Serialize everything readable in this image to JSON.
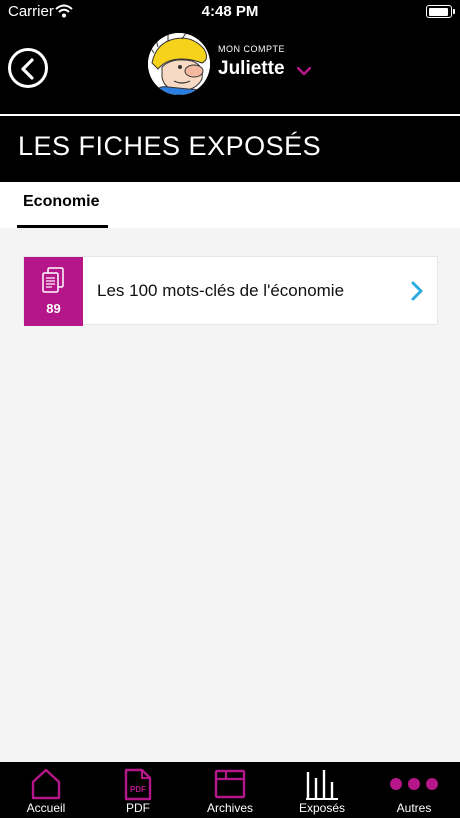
{
  "status_bar": {
    "carrier": "Carrier",
    "time": "4:48 PM"
  },
  "header": {
    "account_label": "MON COMPTE",
    "account_name": "Juliette"
  },
  "page": {
    "title": "LES FICHES EXPOSÉS"
  },
  "tabs": [
    {
      "label": "Economie",
      "active": true
    }
  ],
  "cards": [
    {
      "count": "89",
      "title": "Les 100 mots-clés de l'économie"
    }
  ],
  "colors": {
    "accent": "#b5178a",
    "chevron": "#29abe2",
    "background": "#f4f4f4"
  },
  "tab_nav": {
    "items": [
      {
        "label": "Accueil",
        "icon": "home-icon"
      },
      {
        "label": "PDF",
        "icon": "pdf-icon",
        "icon_text": "PDF"
      },
      {
        "label": "Archives",
        "icon": "archives-icon"
      },
      {
        "label": "Exposés",
        "icon": "bar-chart-icon",
        "active": true
      },
      {
        "label": "Autres",
        "icon": "more-dots-icon"
      }
    ]
  }
}
